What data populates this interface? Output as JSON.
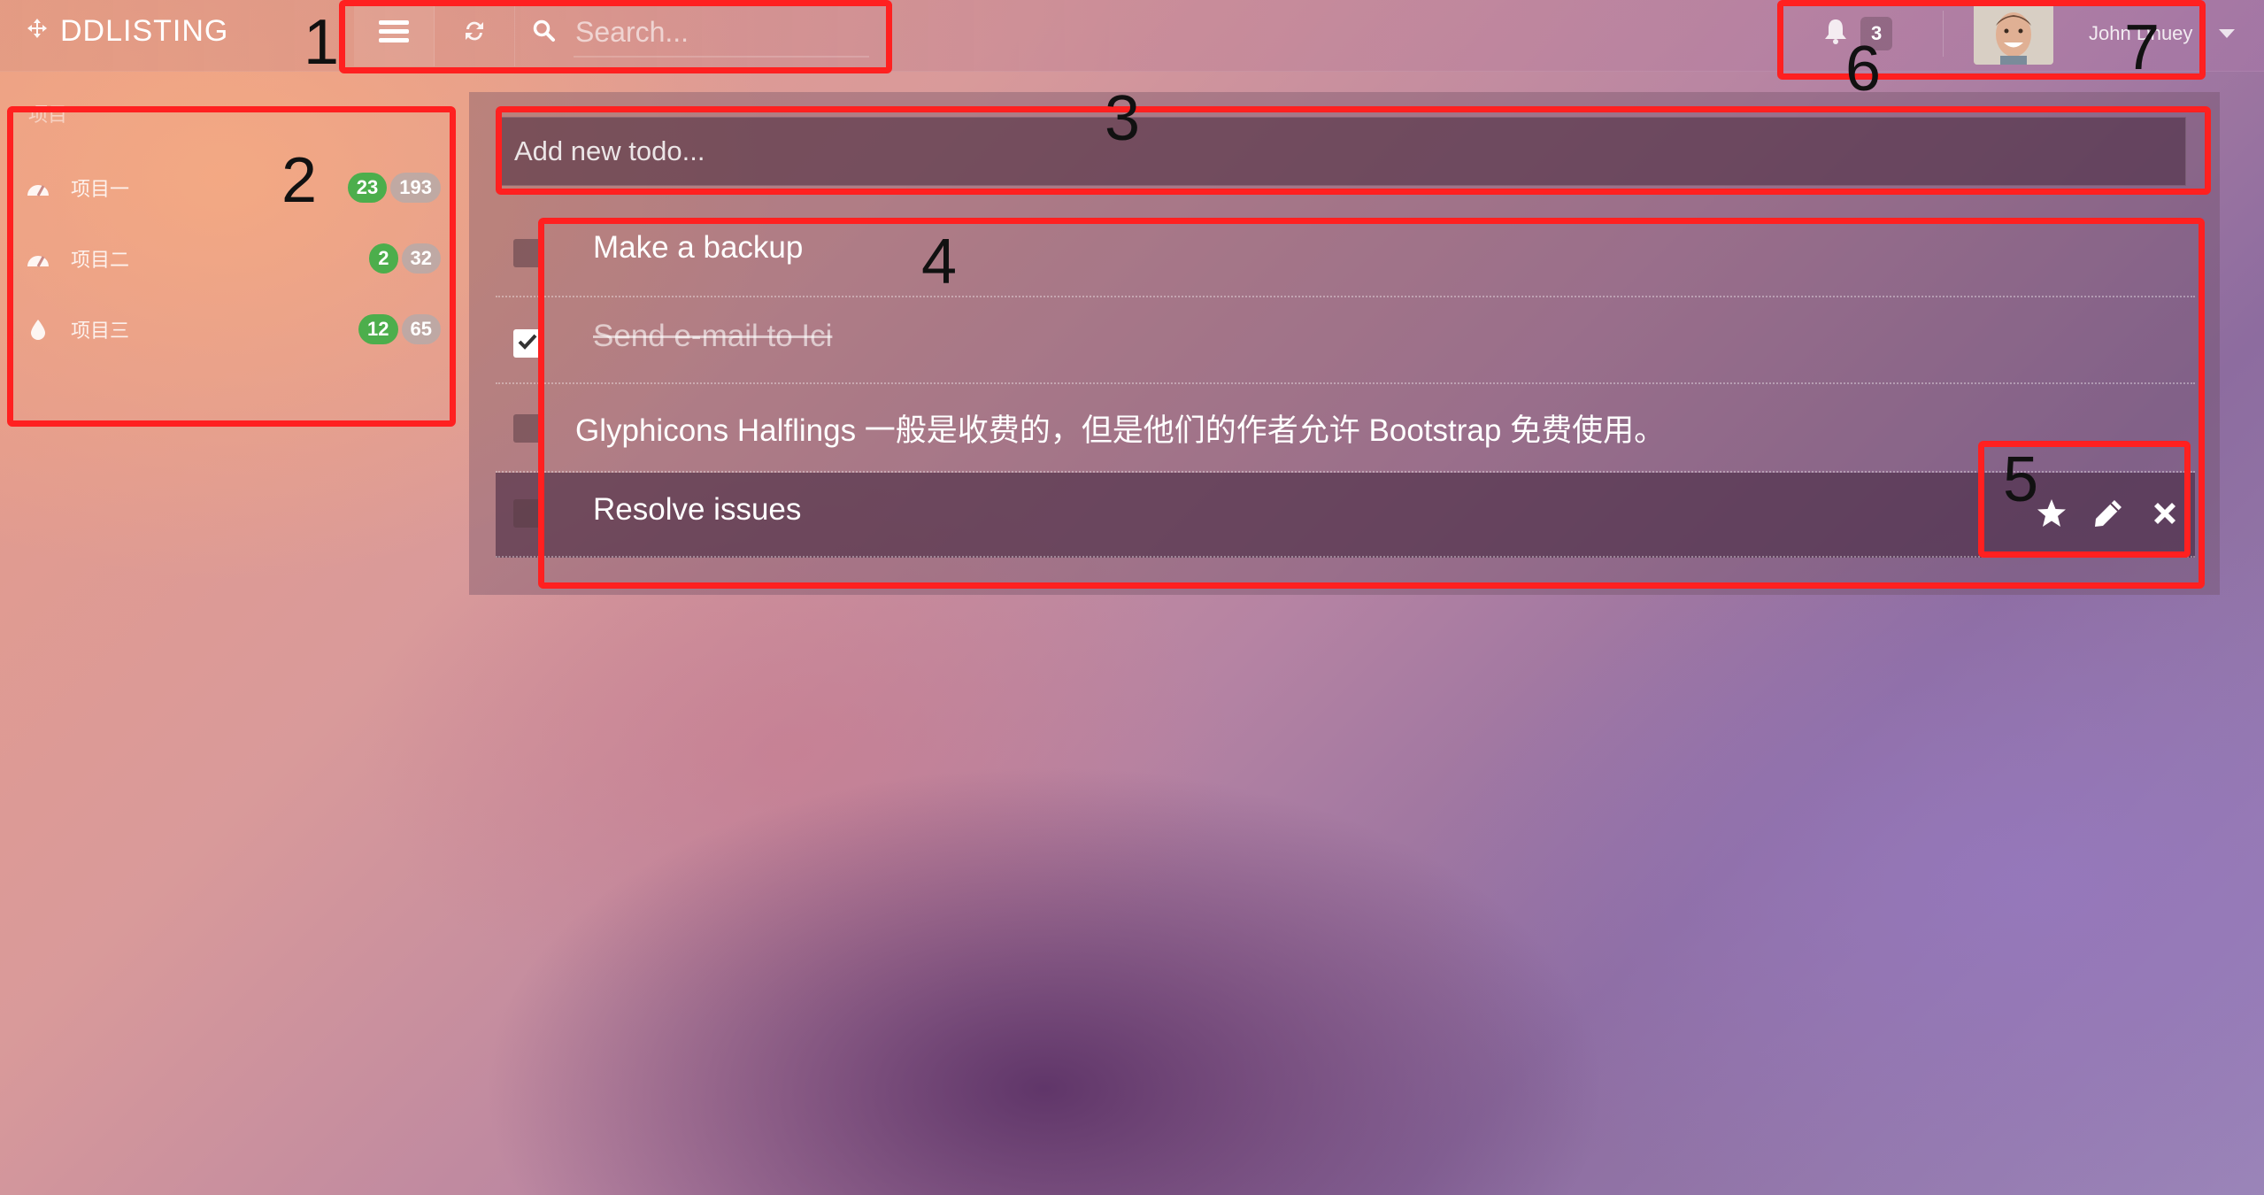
{
  "brand": {
    "name": "DDLISTING",
    "logo_icon": "move-icon"
  },
  "toolbar": {
    "menu_icon": "menu-icon",
    "refresh_icon": "refresh-icon"
  },
  "search": {
    "placeholder": "Search..."
  },
  "notifications": {
    "count": "3",
    "icon": "bell-icon"
  },
  "user": {
    "name": "John Dhuey",
    "avatar_icon": "avatar-photo"
  },
  "sidebar": {
    "title": "项目",
    "items": [
      {
        "label": "项目一",
        "icon": "dashboard-icon",
        "done": "23",
        "total": "193"
      },
      {
        "label": "项目二",
        "icon": "dashboard-icon",
        "done": "2",
        "total": "32"
      },
      {
        "label": "项目三",
        "icon": "drop-icon",
        "done": "12",
        "total": "65"
      }
    ]
  },
  "todo": {
    "add_placeholder": "Add new todo...",
    "items": [
      {
        "text": "Make a backup",
        "checked": false
      },
      {
        "text": "Send e-mail to Ici",
        "checked": true
      },
      {
        "text": "Glyphicons Halflings 一般是收费的，但是他们的作者允许 Bootstrap 免费使用。",
        "checked": false
      },
      {
        "text": "Resolve issues",
        "checked": false
      }
    ]
  },
  "annotations": [
    "1",
    "2",
    "3",
    "4",
    "5",
    "6",
    "7"
  ],
  "colors": {
    "annotation": "#ff2020",
    "badge_green": "#4cae4c"
  }
}
